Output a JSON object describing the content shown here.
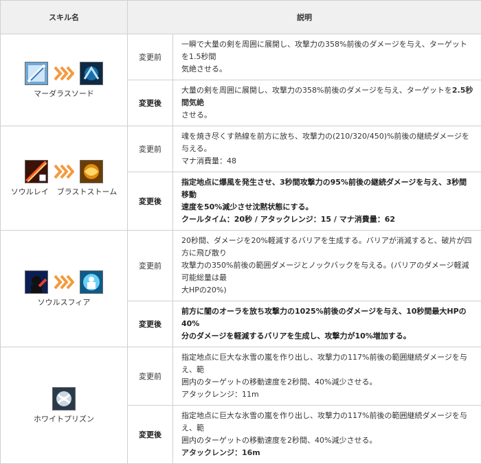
{
  "header": {
    "col_skill": "スキル名",
    "col_desc": "説明"
  },
  "labels": {
    "before": "変更前",
    "after": "変更後"
  },
  "skills": [
    {
      "names": [
        "マーダラスソード"
      ],
      "before": [
        "一瞬で大量の剣を周囲に展開し、攻撃力の358%前後のダメージを与え、ターゲットを1.5秒間",
        "気絶させる。"
      ],
      "after_prefix": "大量の剣を周囲に展開し、攻撃力の358%前後のダメージを与え、ターゲットを",
      "after_strong": "2.5秒間気絶",
      "after_line2": "させる。"
    },
    {
      "names": [
        "ソウルレイ",
        "ブラストストーム"
      ],
      "before": [
        "魂を焼き尽くす熱線を前方に放ち、攻撃力の(210/320/450)%前後の継続ダメージを与える。",
        "マナ消費量：48"
      ],
      "after": [
        "指定地点に爆風を発生させ、3秒間攻撃力の95%前後の継続ダメージを与え、3秒間移動",
        "速度を50%減少させ沈黙状態にする。",
        "クールタイム：20秒 / アタックレンジ：15 / マナ消費量：62"
      ]
    },
    {
      "names": [
        "ソウルスフィア"
      ],
      "before": [
        "20秒間、ダメージを20%軽減するバリアを生成する。バリアが消滅すると、破片が四方に飛び散り",
        "攻撃力の350%前後の範囲ダメージとノックバックを与える。(バリアのダメージ軽減可能総量は最",
        "大HPの20%)"
      ],
      "after": [
        "前方に闇のオーラを放ち攻撃力の1025%前後のダメージを与え、10秒間最大HPの40%",
        "分のダメージを軽減するバリアを生成し、攻撃力が10%増加する。"
      ]
    },
    {
      "names": [
        "ホワイトプリズン"
      ],
      "before": [
        "指定地点に巨大な氷雪の嵐を作り出し、攻撃力の117%前後の範囲継続ダメージを与え、範",
        "囲内のターゲットの移動速度を2秒間、40%減少させる。",
        "アタックレンジ：11m"
      ],
      "after_lines": [
        "指定地点に巨大な氷雪の嵐を作り出し、攻撃力の117%前後の範囲継続ダメージを与え、範",
        "囲内のターゲットの移動速度を2秒間、40%減少させる。"
      ],
      "after_strong": "アタックレンジ：16m"
    }
  ]
}
